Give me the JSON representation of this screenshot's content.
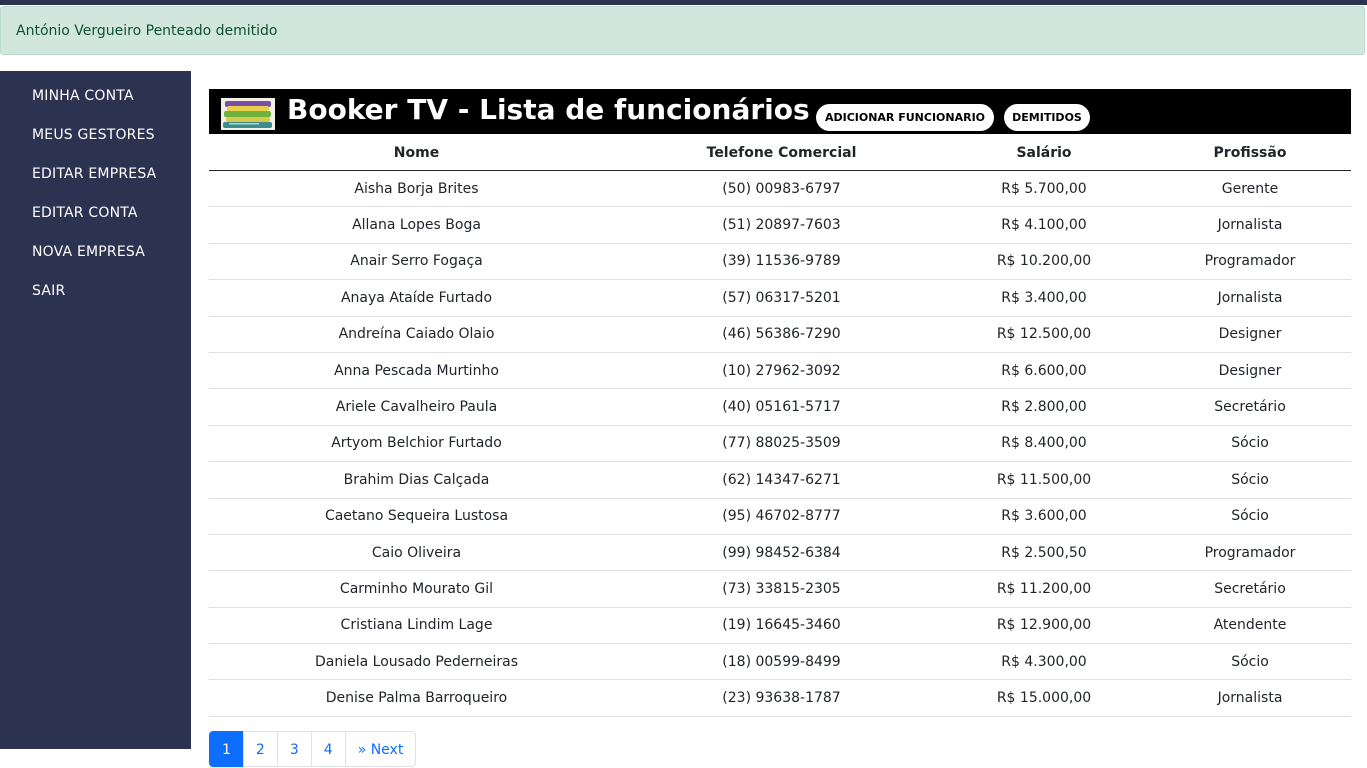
{
  "alert": {
    "message": "António Vergueiro Penteado demitido"
  },
  "sidebar": {
    "items": [
      {
        "label": "MINHA CONTA"
      },
      {
        "label": "MEUS GESTORES"
      },
      {
        "label": "EDITAR EMPRESA"
      },
      {
        "label": "EDITAR CONTA"
      },
      {
        "label": "NOVA EMPRESA"
      },
      {
        "label": "SAIR"
      }
    ]
  },
  "header": {
    "title": "Booker TV - Lista de funcionários",
    "add_label": "ADICIONAR FUNCIONARIO",
    "fired_label": "DEMITIDOS"
  },
  "table": {
    "columns": [
      "Nome",
      "Telefone Comercial",
      "Salário",
      "Profissão"
    ],
    "rows": [
      [
        "Aisha Borja Brites",
        "(50) 00983-6797",
        "R$ 5.700,00",
        "Gerente"
      ],
      [
        "Allana Lopes Boga",
        "(51) 20897-7603",
        "R$ 4.100,00",
        "Jornalista"
      ],
      [
        "Anair Serro Fogaça",
        "(39) 11536-9789",
        "R$ 10.200,00",
        "Programador"
      ],
      [
        "Anaya Ataíde Furtado",
        "(57) 06317-5201",
        "R$ 3.400,00",
        "Jornalista"
      ],
      [
        "Andreína Caiado Olaio",
        "(46) 56386-7290",
        "R$ 12.500,00",
        "Designer"
      ],
      [
        "Anna Pescada Murtinho",
        "(10) 27962-3092",
        "R$ 6.600,00",
        "Designer"
      ],
      [
        "Ariele Cavalheiro Paula",
        "(40) 05161-5717",
        "R$ 2.800,00",
        "Secretário"
      ],
      [
        "Artyom Belchior Furtado",
        "(77) 88025-3509",
        "R$ 8.400,00",
        "Sócio"
      ],
      [
        "Brahim Dias Calçada",
        "(62) 14347-6271",
        "R$ 11.500,00",
        "Sócio"
      ],
      [
        "Caetano Sequeira Lustosa",
        "(95) 46702-8777",
        "R$ 3.600,00",
        "Sócio"
      ],
      [
        "Caio Oliveira",
        "(99) 98452-6384",
        "R$ 2.500,50",
        "Programador"
      ],
      [
        "Carminho Mourato Gil",
        "(73) 33815-2305",
        "R$ 11.200,00",
        "Secretário"
      ],
      [
        "Cristiana Lindim Lage",
        "(19) 16645-3460",
        "R$ 12.900,00",
        "Atendente"
      ],
      [
        "Daniela Lousado Pederneiras",
        "(18) 00599-8499",
        "R$ 4.300,00",
        "Sócio"
      ],
      [
        "Denise Palma Barroqueiro",
        "(23) 93638-1787",
        "R$ 15.000,00",
        "Jornalista"
      ]
    ]
  },
  "pagination": {
    "pages": [
      "1",
      "2",
      "3",
      "4"
    ],
    "next_label": "» Next",
    "current": "1"
  },
  "colors": {
    "sidebar_bg": "#2b3350",
    "alert_bg": "#d1e7dd",
    "alert_text": "#0f5132",
    "banner_bg": "#000000",
    "link": "#0d6efd"
  }
}
